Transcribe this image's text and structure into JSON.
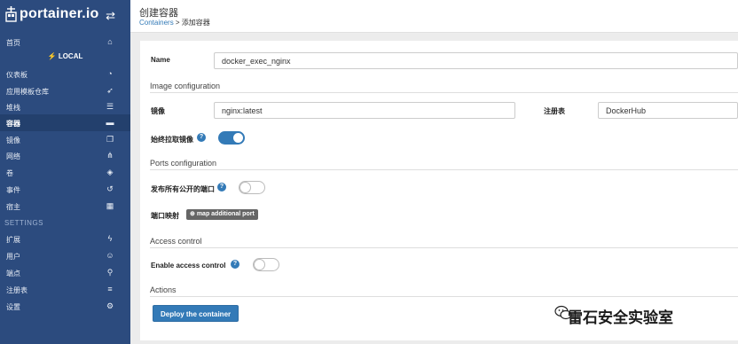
{
  "brand": {
    "logo_text": "portainer.io"
  },
  "sidebar": {
    "home": "首页",
    "endpoint_header": "LOCAL",
    "items": [
      {
        "label": "仪表板"
      },
      {
        "label": "应用模板仓库"
      },
      {
        "label": "堆栈"
      },
      {
        "label": "容器"
      },
      {
        "label": "镜像"
      },
      {
        "label": "网络"
      },
      {
        "label": "卷"
      },
      {
        "label": "事件"
      },
      {
        "label": "宿主"
      }
    ],
    "settings_header": "SETTINGS",
    "settings_items": [
      {
        "label": "扩展"
      },
      {
        "label": "用户"
      },
      {
        "label": "端点"
      },
      {
        "label": "注册表"
      },
      {
        "label": "设置"
      }
    ]
  },
  "header": {
    "title": "创建容器",
    "breadcrumb_link": "Containers",
    "breadcrumb_rest": " > 添加容器"
  },
  "form": {
    "name_label": "Name",
    "name_value": "docker_exec_nginx",
    "image_section": "Image configuration",
    "image_label": "镜像",
    "image_value": "nginx:latest",
    "registry_label": "注册表",
    "registry_value": "DockerHub",
    "always_pull_label": "始终拉取镜像",
    "ports_section": "Ports configuration",
    "publish_all_label": "发布所有公开的端口",
    "port_mapping_label": "端口映射",
    "map_port_button": "map additional port",
    "access_section": "Access control",
    "enable_access_label": "Enable access control",
    "actions_section": "Actions",
    "deploy_button": "Deploy the container"
  },
  "state": {
    "always_pull": true,
    "publish_all": false,
    "access_control": false
  },
  "watermark": "雷石安全实验室"
}
